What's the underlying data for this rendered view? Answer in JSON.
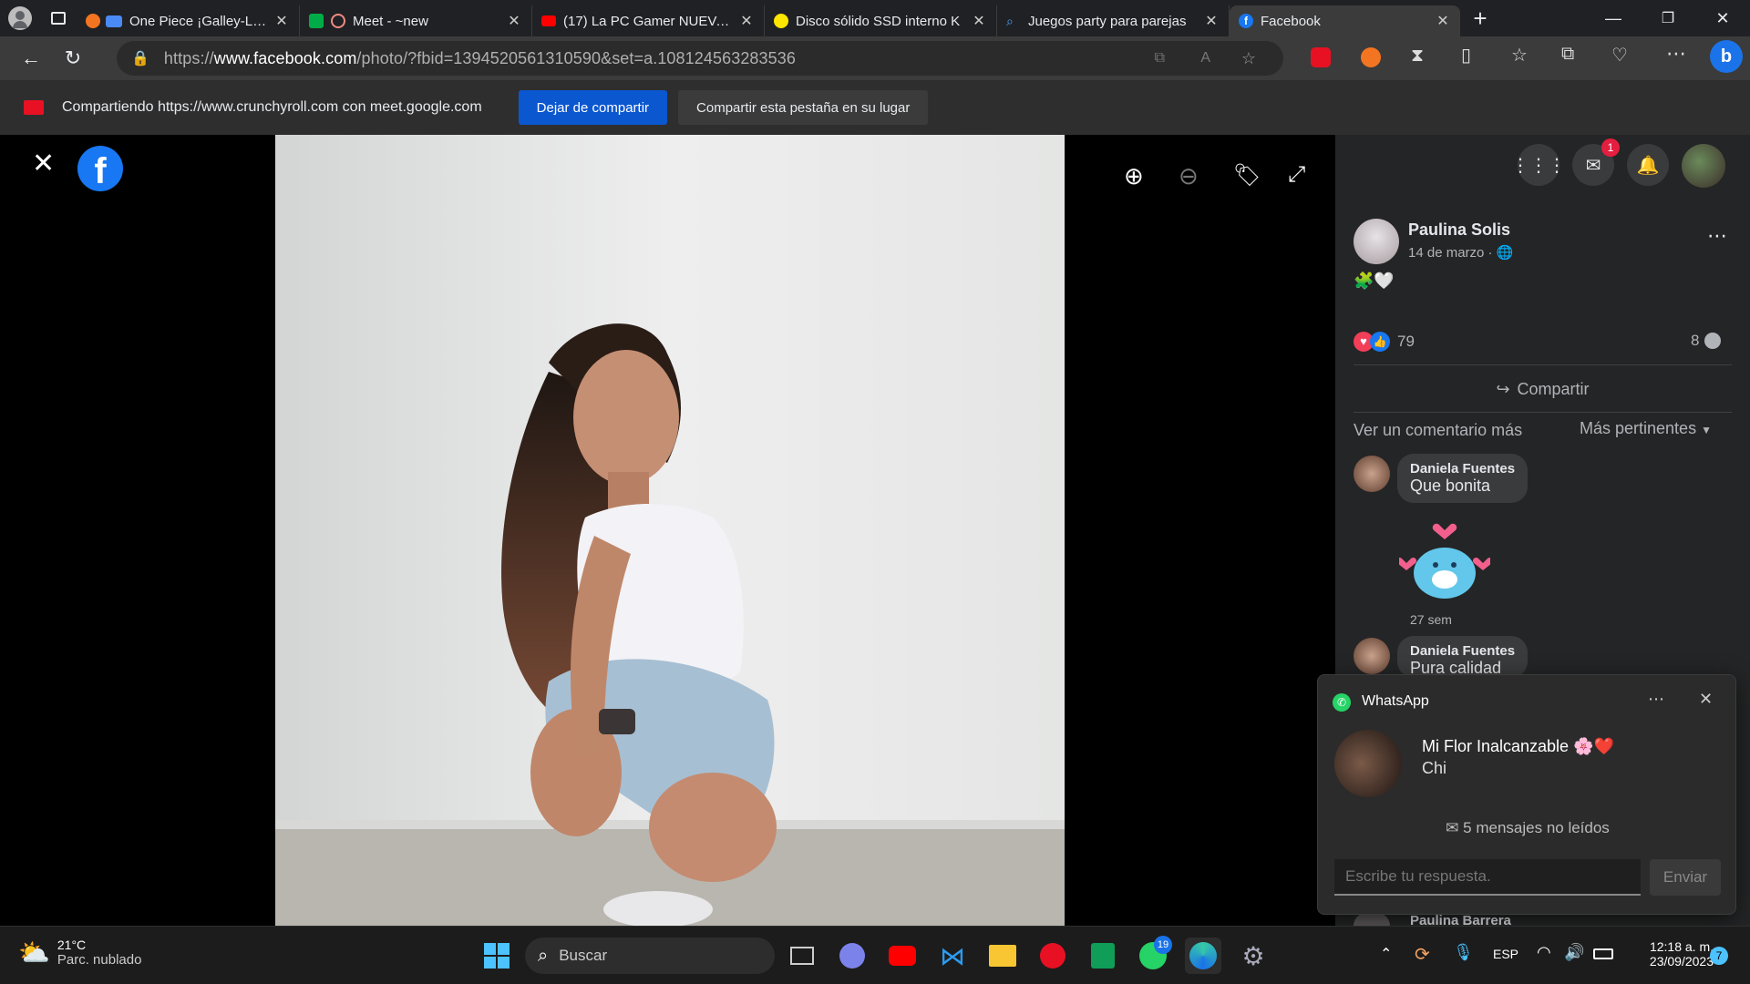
{
  "browser": {
    "tabs": [
      {
        "title": "One Piece ¡Galley-La C",
        "favicon": "crunchyroll-icon",
        "color": "#f47521"
      },
      {
        "title": "Meet - ~new",
        "favicon": "meet-icon",
        "color": "#00ac47"
      },
      {
        "title": "(17) La PC Gamer NUEVA m",
        "favicon": "youtube-icon",
        "color": "#ff0000"
      },
      {
        "title": "Disco sólido SSD interno K",
        "favicon": "mercadolibre-icon",
        "color": "#ffe600"
      },
      {
        "title": "Juegos party para parejas",
        "favicon": "search-icon",
        "color": "#4ea1ff"
      },
      {
        "title": "Facebook",
        "favicon": "facebook-icon",
        "color": "#1877f2"
      }
    ],
    "url_prefix": "https://",
    "url_host": "www.facebook.com",
    "url_path": "/photo/?fbid=1394520561310590&set=a.108124563283536"
  },
  "sharebar": {
    "text": "Compartiendo https://www.crunchyroll.com con meet.google.com",
    "stop_button": "Dejar de compartir",
    "share_this_button": "Compartir esta pestaña en su lugar"
  },
  "post": {
    "author": "Paulina Solis",
    "date": "14 de marzo ·",
    "caption_emoji": "🧩🤍",
    "reactions_count": "79",
    "comments_count": "8",
    "share_label": "Compartir",
    "more_comments": "Ver un comentario más",
    "sort_label": "Más pertinentes",
    "comments": [
      {
        "author": "Daniela Fuentes",
        "text": "Que bonita",
        "time": "27 sem"
      },
      {
        "author": "Daniela Fuentes",
        "text": "Pura calidad"
      },
      {
        "author": "Paulina Barrera",
        "text": ""
      }
    ]
  },
  "header_icons": {
    "messenger_badge": "1"
  },
  "toast": {
    "app": "WhatsApp",
    "sender": "Mi Flor Inalcanzable 🌸❤️",
    "message": "Chi",
    "unread": "5 mensajes no leídos",
    "reply_placeholder": "Escribe tu respuesta.",
    "send_label": "Enviar"
  },
  "taskbar": {
    "weather_temp": "21°C",
    "weather_desc": "Parc. nublado",
    "search_label": "Buscar",
    "whatsapp_badge": "19",
    "language": "ESP",
    "time": "12:18 a. m.",
    "date": "23/09/2023",
    "notification_count": "7"
  },
  "colors": {
    "facebook_blue": "#1877f2",
    "whatsapp_green": "#25d366",
    "share_button": "#0b57d0"
  }
}
